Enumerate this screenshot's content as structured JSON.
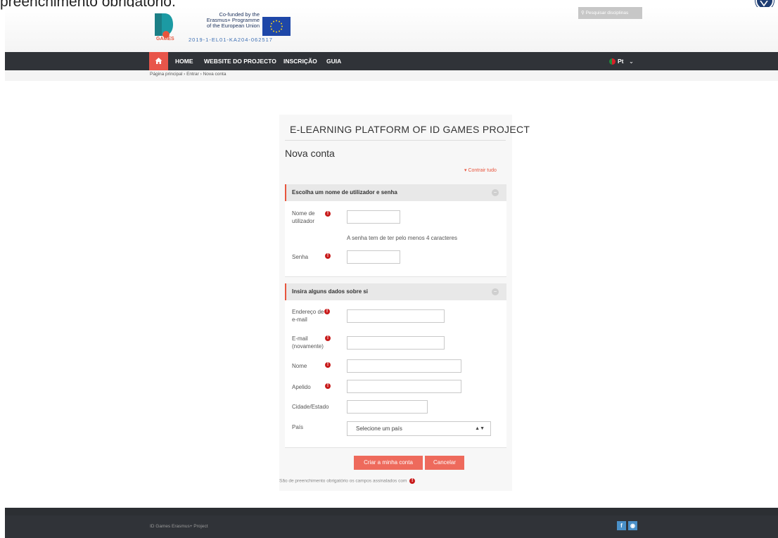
{
  "doc_fragment": "preenchimento obrigatório.",
  "header": {
    "logo_text": "GAMES",
    "eu_text_1": "Co-funded by the",
    "eu_text_2": "Erasmus+ Programme",
    "eu_text_3": "of the European Union",
    "eu_code": "2019-1-EL01-KA204-062517",
    "search_placeholder": "Pesquisar disciplinas"
  },
  "nav": {
    "items": [
      "HOME",
      "WEBSITE DO PROJECTO",
      "INSCRIÇÃO",
      "GUIA"
    ],
    "lang": "Pt"
  },
  "breadcrumb": {
    "items": [
      "Página principal",
      "Entrar",
      "Nova conta"
    ],
    "sep": "›"
  },
  "form": {
    "site_title": "E-LEARNING PLATFORM OF ID GAMES PROJECT",
    "heading": "Nova conta",
    "collapse_all": "Contrair tudo",
    "section1": {
      "title": "Escolha um nome de utilizador e senha",
      "username_label_1": "Nome de",
      "username_label_2": "utilizador",
      "password_help": "A senha tem de ter pelo menos 4 caracteres",
      "password_label": "Senha"
    },
    "section2": {
      "title": "Insira alguns dados sobre si",
      "email_label_1": "Endereço de",
      "email_label_2": "e-mail",
      "email2_label_1": "E-mail",
      "email2_label_2": "(novamente)",
      "firstname_label": "Nome",
      "lastname_label": "Apelido",
      "city_label": "Cidade/Estado",
      "country_label": "País",
      "country_value": "Selecione um país"
    },
    "submit_label": "Criar a minha conta",
    "cancel_label": "Cancelar",
    "required_note": "São de preenchimento obrigatório os campos assinalados com"
  },
  "footer": {
    "text": "ID Games Erasmus+ Project",
    "facebook": "f",
    "web": "◉"
  },
  "colors": {
    "accent": "#e8553d",
    "navbar": "#303338",
    "button": "#ee6a5c"
  }
}
